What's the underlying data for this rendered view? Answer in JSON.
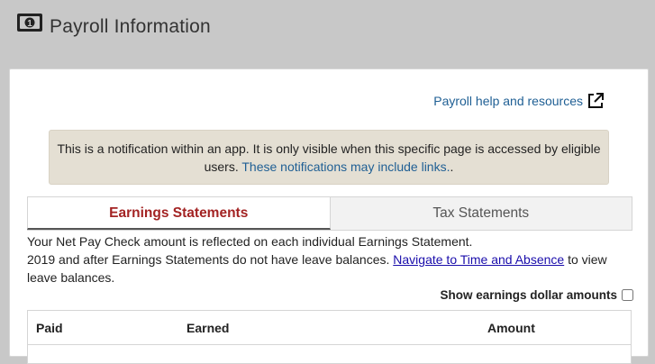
{
  "header": {
    "title": "Payroll Information",
    "icon": "money-bill-icon"
  },
  "help": {
    "link_label": "Payroll help and resources",
    "icon": "external-link-icon"
  },
  "notification": {
    "text": "This is a notification within an app. It is only visible when this specific page is accessed by eligible users.",
    "link_label": "These notifications may include links.",
    "trailing": "."
  },
  "tabs": [
    {
      "label": "Earnings Statements",
      "active": true
    },
    {
      "label": "Tax Statements",
      "active": false
    }
  ],
  "info": {
    "line1": "Your Net Pay Check amount is reflected on each individual Earnings Statement.",
    "line2_prefix": "2019 and after Earnings Statements do not have leave balances.",
    "line2_link": "Navigate to Time and Absence",
    "line2_suffix": "to view leave balances."
  },
  "toggle": {
    "label": "Show earnings dollar amounts",
    "checked": false
  },
  "table": {
    "columns": [
      "Paid",
      "Earned",
      "Amount"
    ]
  },
  "colors": {
    "active_tab": "#a32323",
    "link": "#1f5f94",
    "notice_bg": "#e4dfd3",
    "page_bg": "#c8c8c8"
  }
}
